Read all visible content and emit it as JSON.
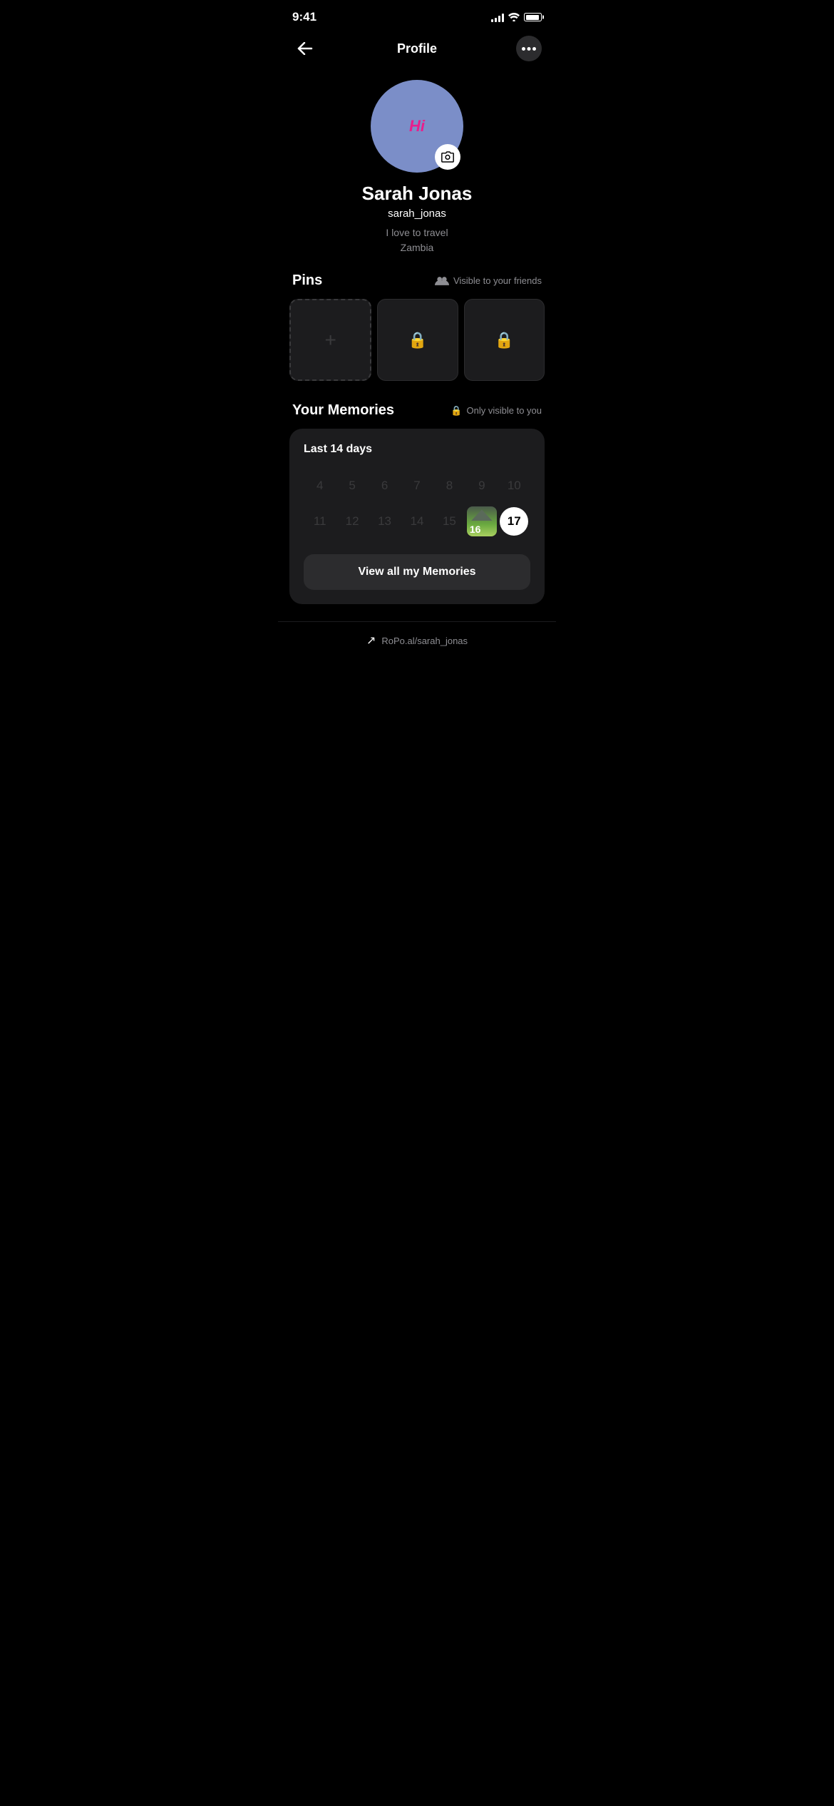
{
  "statusBar": {
    "time": "9:41",
    "signalBars": [
      4,
      6,
      8,
      10,
      12
    ],
    "batteryPercent": 90
  },
  "nav": {
    "backLabel": "←",
    "title": "Profile",
    "moreLabel": "•••"
  },
  "profile": {
    "avatarInitials": "Hi",
    "name": "Sarah Jonas",
    "username": "sarah_jonas",
    "bio": "I love to travel",
    "location": "Zambia"
  },
  "pins": {
    "sectionTitle": "Pins",
    "visibility": "Visible to your friends",
    "addLabel": "+",
    "tiles": [
      {
        "type": "add"
      },
      {
        "type": "locked"
      },
      {
        "type": "locked"
      }
    ]
  },
  "memories": {
    "sectionTitle": "Your Memories",
    "visibility": "Only visible to you",
    "cardLabel": "Last 14 days",
    "calendarRow1": [
      "4",
      "5",
      "6",
      "7",
      "8",
      "9",
      "10"
    ],
    "calendarRow2": [
      "11",
      "12",
      "13",
      "14",
      "15",
      "16",
      "17"
    ],
    "activeDay": "16",
    "todayDay": "17",
    "viewAllLabel": "View all my Memories"
  },
  "bottomBar": {
    "username": "RoPo.al/sarah_jonas"
  }
}
